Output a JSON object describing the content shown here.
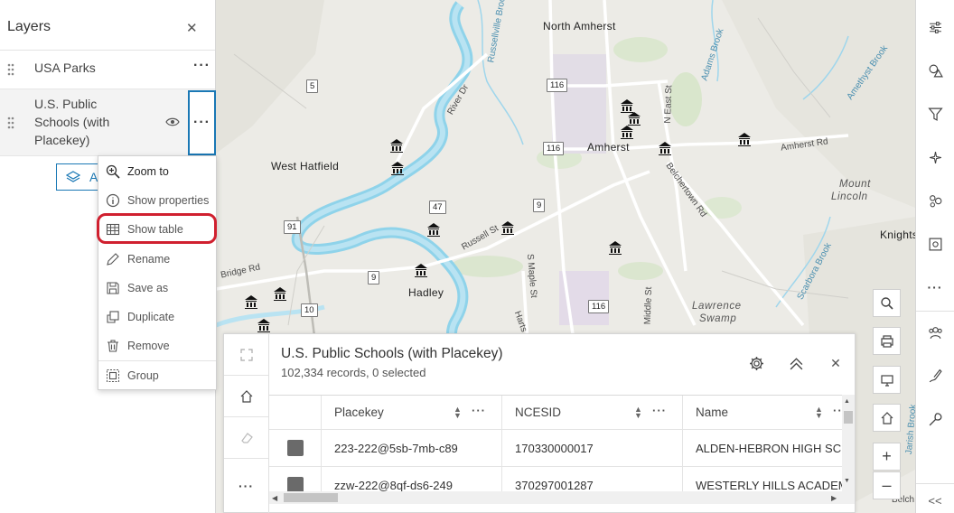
{
  "layers_panel": {
    "title": "Layers",
    "close_icon": "close-icon",
    "layers": [
      {
        "name": "USA Parks"
      },
      {
        "name": "U.S. Public Schools (with Placekey)",
        "name_lines": [
          "U.S. Public",
          "Schools (with",
          "Placekey)"
        ]
      }
    ],
    "add_button_label": "A"
  },
  "context_menu": {
    "items": [
      {
        "label": "Zoom to",
        "icon": "zoom-in-icon"
      },
      {
        "label": "Show properties",
        "icon": "info-icon"
      },
      {
        "label": "Show table",
        "icon": "table-icon"
      },
      {
        "label": "Rename",
        "icon": "pencil-icon"
      },
      {
        "label": "Save as",
        "icon": "save-icon"
      },
      {
        "label": "Duplicate",
        "icon": "duplicate-icon"
      },
      {
        "label": "Remove",
        "icon": "trash-icon"
      },
      {
        "label": "Group",
        "icon": "group-icon"
      }
    ],
    "highlighted": "Show table",
    "highlight_color": "#d0202f"
  },
  "map": {
    "labels": {
      "north_amherst": "North Amherst",
      "amherst": "Amherst",
      "west_hatfield": "West Hatfield",
      "hadley": "Hadley",
      "mount_lincoln_1": "Mount",
      "mount_lincoln_2": "Lincoln",
      "lawrence_swamp_1": "Lawrence",
      "lawrence_swamp_2": "Swamp",
      "knights": "Knights",
      "river_dr": "River Dr",
      "russellville": "Russellville Brook",
      "n_east_st": "N East St",
      "amherst_rd": "Amherst Rd",
      "belchertown_rd": "Belchertown Rd",
      "russell_st": "Russell St",
      "s_maple_st": "S Maple St",
      "middle_st": "Middle St",
      "bridge_rd": "Bridge Rd",
      "scarbora": "Scarbora Brook",
      "amethyst": "Amethyst Brook",
      "adams_brook": "Adams Brook",
      "harts": "Harts B",
      "jarish": "Jarish Brook",
      "belch": "Belch"
    },
    "shields": [
      "116",
      "116",
      "116",
      "5",
      "47",
      "9",
      "9",
      "91",
      "10"
    ],
    "water_color": "#b9e3f2",
    "river_color": "#8fd3ea"
  },
  "attribute_table": {
    "title": "U.S. Public Schools (with Placekey)",
    "subtitle": "102,334 records, 0 selected",
    "columns": [
      "Placekey",
      "NCESID",
      "Name"
    ],
    "rows": [
      {
        "placekey": "223-222@5sb-7mb-c89",
        "ncesid": "170330000017",
        "name": "ALDEN-HEBRON HIGH SC"
      },
      {
        "placekey": "zzw-222@8qf-ds6-249",
        "ncesid": "370297001287",
        "name": "WESTERLY HILLS ACADEM"
      }
    ]
  },
  "right_toolbar": {
    "icons": [
      "sliders-icon",
      "shapes-icon",
      "filter-icon",
      "effects-icon",
      "cluster-icon",
      "configure-pop-up-icon",
      "more-icon",
      "users-icon",
      "sketch-icon",
      "tools-icon",
      "collapse-icon"
    ],
    "collapse_label": "<<"
  },
  "zoom": {
    "in_label": "+",
    "out_label": "–"
  }
}
